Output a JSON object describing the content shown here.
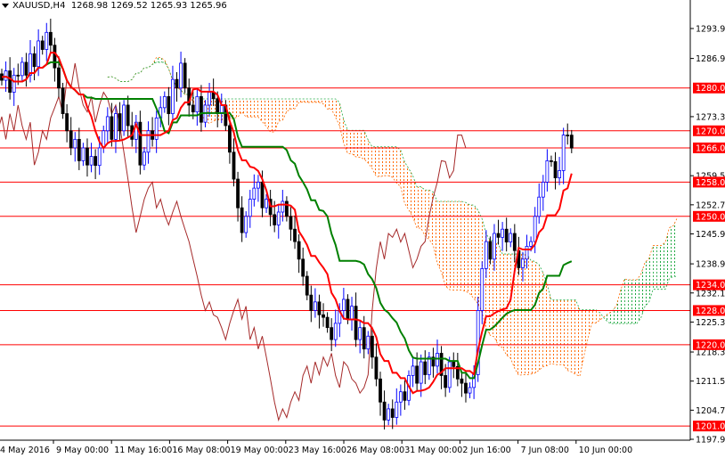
{
  "header": {
    "symbol": "XAUUSD,H4",
    "ohlc": "1268.98 1269.52 1265.93 1265.96"
  },
  "colors": {
    "bull": "#0000ff",
    "bear": "#000000",
    "tenkan": "#ff0000",
    "kijun": "#008000",
    "chikou": "#a52a2a",
    "cloud_bull": "#22aa44",
    "cloud_bear": "#ff6a00",
    "level": "#ff0000"
  },
  "chart_data": {
    "type": "candlestick",
    "title": "XAUUSD,H4",
    "indicator": "Ichimoku Kinko Hyo (9,26,52)",
    "ylim": [
      1197.9,
      1293.9
    ],
    "y_ticks": [
      "1293.90",
      "1286.90",
      "1273.30",
      "1259.50",
      "1252.70",
      "1245.90",
      "1238.90",
      "1232.10",
      "1225.30",
      "1218.30",
      "1211.50",
      "1204.70",
      "1197.90"
    ],
    "x_ticks": [
      "4 May 2016",
      "9 May 00:00",
      "11 May 16:00",
      "16 May 08:00",
      "19 May 00:00",
      "23 May 16:00",
      "26 May 08:00",
      "31 May 00:00",
      "2 Jun 16:00",
      "7 Jun 08:00",
      "10 Jun 00:00"
    ],
    "levels": [
      "1280.00",
      "1270.00",
      "1266.00",
      "1258.00",
      "1250.00",
      "1234.00",
      "1228.00",
      "1220.00",
      "1201.00"
    ],
    "closes": [
      1281.8,
      1284,
      1279,
      1283,
      1282.9,
      1286,
      1283,
      1288,
      1285,
      1291,
      1289,
      1293,
      1290,
      1284.7,
      1280,
      1274,
      1270,
      1266,
      1268,
      1263,
      1266,
      1262,
      1264,
      1261.9,
      1266,
      1270,
      1273.3,
      1268,
      1274,
      1270,
      1276,
      1271.2,
      1268,
      1272,
      1262,
      1265,
      1270,
      1268,
      1273,
      1275.4,
      1278,
      1274,
      1282,
      1280,
      1285.8,
      1280,
      1276,
      1274.4,
      1278,
      1272,
      1276,
      1279,
      1277.5,
      1274,
      1276,
      1271.2,
      1265,
      1258.7,
      1252,
      1246.2,
      1250,
      1254,
      1256.6,
      1258,
      1252,
      1254,
      1250.4,
      1248,
      1251,
      1253.5,
      1250,
      1247,
      1244.1,
      1240,
      1236,
      1231.6,
      1228,
      1230,
      1227,
      1226.4,
      1224,
      1221.2,
      1225,
      1228,
      1230.6,
      1226,
      1229,
      1221.2,
      1224,
      1219,
      1222,
      1217.1,
      1212,
      1206.6,
      1202.4,
      1205,
      1203,
      1206.6,
      1209,
      1207,
      1212.8,
      1215,
      1211,
      1216,
      1213,
      1217.1,
      1215,
      1218,
      1212.8,
      1210,
      1216,
      1214.9,
      1212,
      1211,
      1208.7,
      1210,
      1213,
      1228,
      1237.8,
      1244.1,
      1240,
      1246,
      1245.1,
      1247,
      1244,
      1246,
      1242,
      1238,
      1240,
      1243,
      1244.1,
      1250,
      1254.5,
      1258,
      1263,
      1262.8,
      1259,
      1260.7,
      1269,
      1268.98,
      1265.96
    ]
  }
}
